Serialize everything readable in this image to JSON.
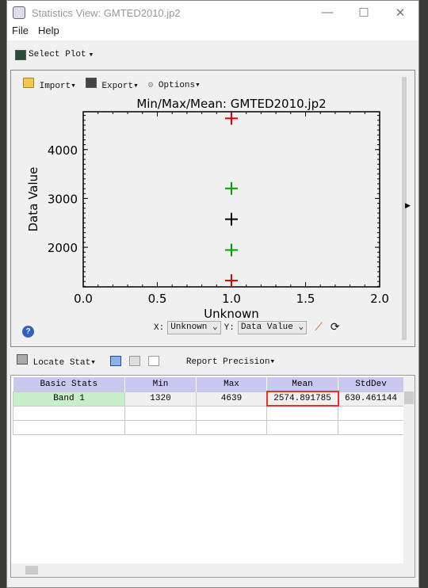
{
  "window": {
    "title": "Statistics View: GMTED2010.jp2",
    "minimize": "—",
    "maximize": "☐",
    "close": "✕"
  },
  "menu": [
    "File",
    "Help"
  ],
  "toolbar": {
    "select_plot": "Select Plot"
  },
  "plot_toolbar": {
    "import": "Import",
    "export": "Export",
    "options": "Options"
  },
  "chart_data": {
    "type": "scatter",
    "title": "Min/Max/Mean: GMTED2010.jp2",
    "xlabel": "Unknown",
    "ylabel": "Data Value",
    "xlim": [
      0,
      2
    ],
    "ylim": [
      1190,
      4775
    ],
    "xticks": [
      "0.0",
      "0.5",
      "1.0",
      "1.5",
      "2.0"
    ],
    "yticks": [
      "2000",
      "3000",
      "4000"
    ],
    "points": [
      {
        "label": "Max",
        "x": 1,
        "y": 4639,
        "color": "#e00000"
      },
      {
        "label": "Mean+StdDev",
        "x": 1,
        "y": 3205.35,
        "color": "#00a000"
      },
      {
        "label": "Mean",
        "x": 1,
        "y": 2574.89,
        "color": "#000000"
      },
      {
        "label": "Mean-StdDev",
        "x": 1,
        "y": 1944.43,
        "color": "#00a000"
      },
      {
        "label": "Min",
        "x": 1,
        "y": 1320,
        "color": "#e00000"
      }
    ]
  },
  "axis_select": {
    "x_label": "X:",
    "x_value": "Unknown",
    "y_label": "Y:",
    "y_value": "Data Value"
  },
  "stats_toolbar": {
    "locate_stat": "Locate Stat",
    "report_precision": "Report Precision"
  },
  "table": {
    "headers": [
      "Basic Stats",
      "Min",
      "Max",
      "Mean",
      "StdDev"
    ],
    "rows": [
      [
        "Band 1",
        "1320",
        "4639",
        "2574.891785",
        "630.461144"
      ]
    ]
  },
  "highlight_color": "#e83030"
}
